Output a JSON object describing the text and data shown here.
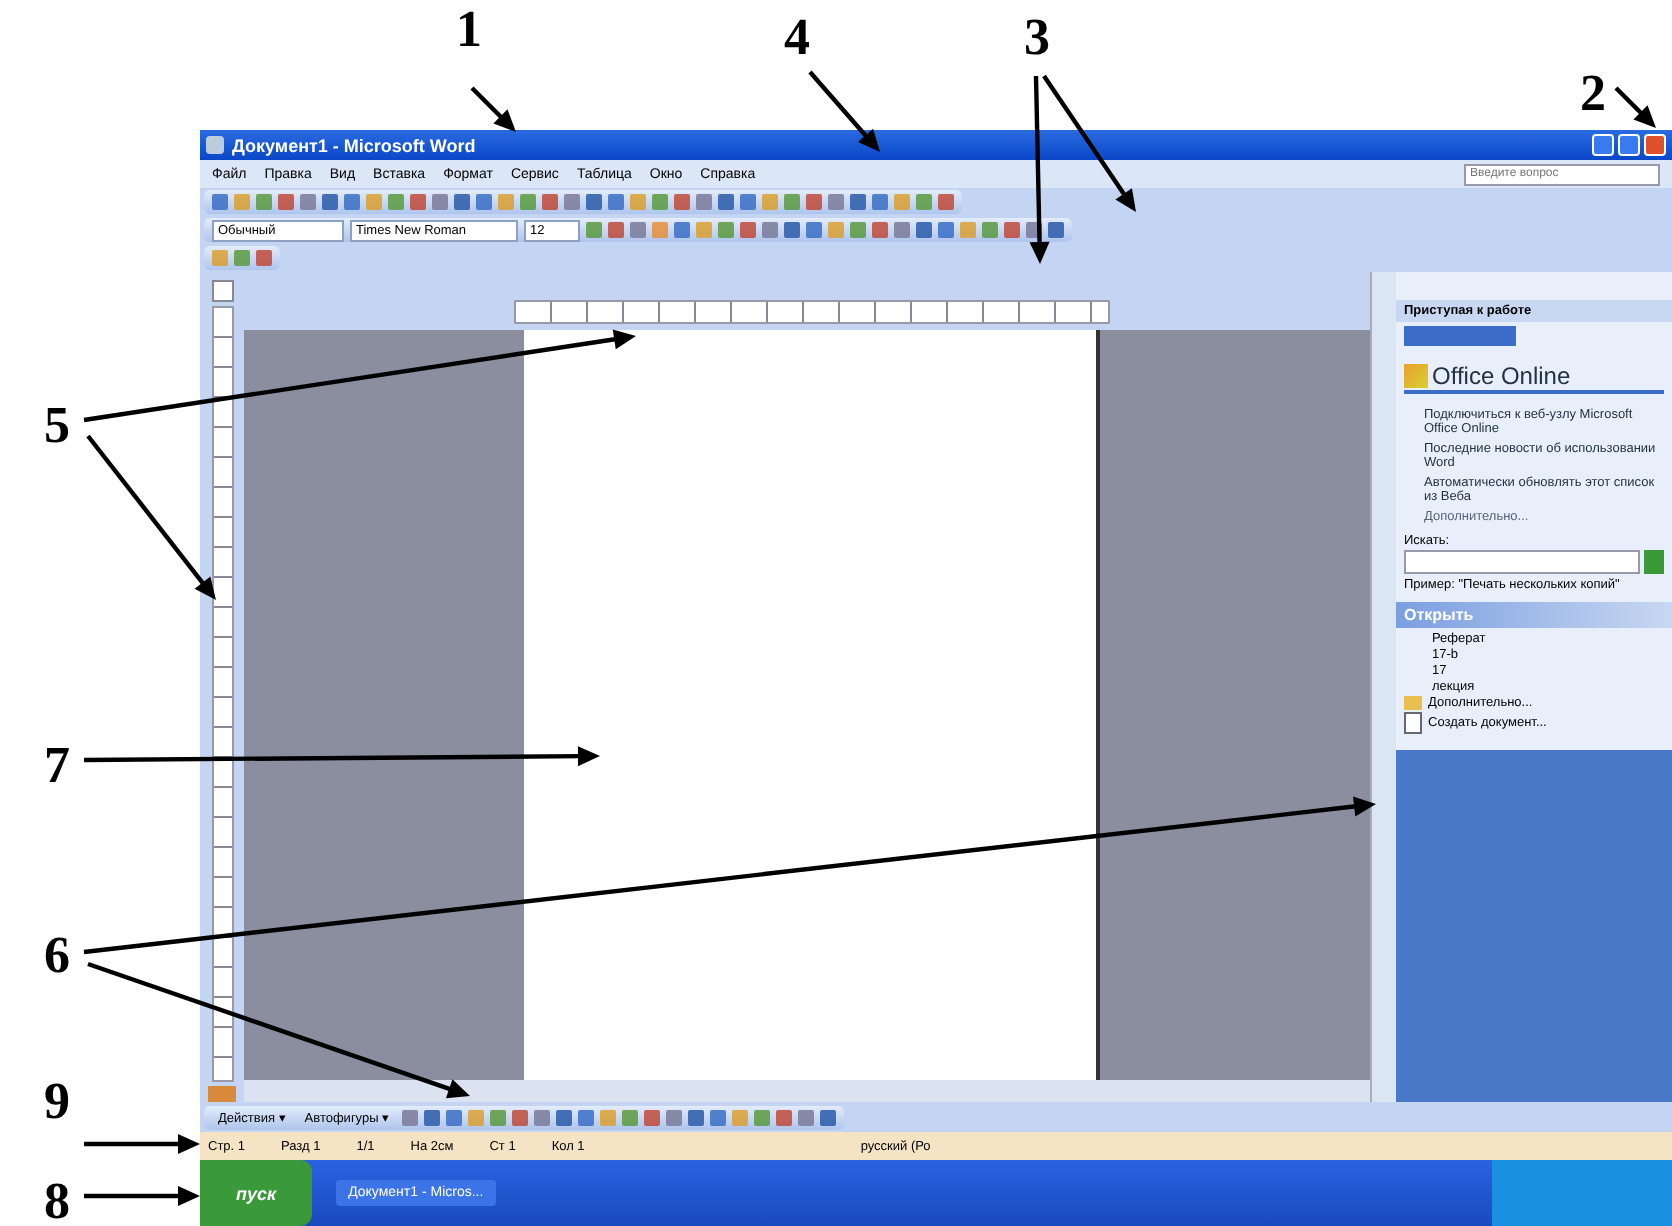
{
  "window": {
    "title": "Документ1 - Microsoft Word"
  },
  "menu": [
    "Файл",
    "Правка",
    "Вид",
    "Вставка",
    "Формат",
    "Сервис",
    "Таблица",
    "Окно",
    "Справка"
  ],
  "help_box": {
    "placeholder": "Введите вопрос"
  },
  "format_toolbar": {
    "style": "Обычный",
    "font": "Times New Roman",
    "size": "12"
  },
  "task_pane": {
    "title": "Приступая к работе",
    "logo": "Office Online",
    "links": [
      "Подключиться к веб-узлу Microsoft Office Online",
      "Последние новости об использовании Word",
      "Автоматически обновлять этот список из Веба"
    ],
    "more": "Дополнительно...",
    "search_label": "Искать:",
    "search_example": "Пример: \"Печать нескольких копий\"",
    "open_header": "Открыть",
    "files": [
      "Реферат",
      "17-b",
      "17",
      "лекция"
    ],
    "open_more": "Дополнительно...",
    "create": "Создать документ..."
  },
  "drawing_toolbar": {
    "actions": "Действия ▾",
    "autoshapes": "Автофигуры ▾"
  },
  "status_bar": [
    "Стр. 1",
    "Разд 1",
    "1/1",
    "На 2см",
    "Ст 1",
    "Кол 1",
    "русский (Ро"
  ],
  "taskbar": {
    "start": "пуск",
    "window": "Документ1 - Micros..."
  },
  "annotations": [
    "1",
    "4",
    "3",
    "2",
    "5",
    "7",
    "6",
    "9",
    "8"
  ]
}
